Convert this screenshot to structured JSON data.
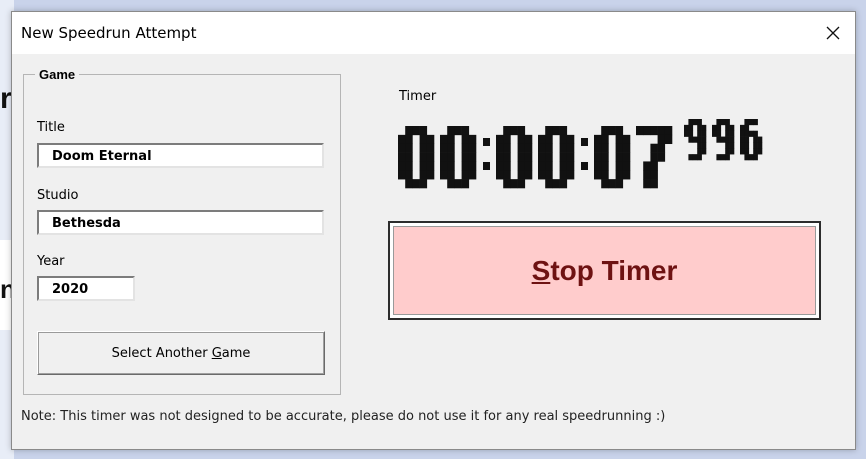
{
  "window": {
    "title": "New Speedrun Attempt",
    "close_icon": "close-icon"
  },
  "game_group": {
    "legend": "Game",
    "title_label": "Title",
    "title_value": "Doom Eternal",
    "studio_label": "Studio",
    "studio_value": "Bethesda",
    "year_label": "Year",
    "year_value": "2020",
    "select_button": {
      "before": "Select Another ",
      "accel": "G",
      "after": "ame"
    }
  },
  "timer": {
    "label": "Timer",
    "hours": "00",
    "minutes": "00",
    "seconds": "07",
    "milliseconds": "996"
  },
  "stop_button": {
    "accel": "S",
    "rest": "top Timer",
    "bg_color": "#ffcccc",
    "text_color": "#6e1212"
  },
  "note": "Note: This timer was not designed to be accurate, please do not use it for any real speedrunning :)",
  "background_app": {
    "glyphs": [
      "r",
      "n"
    ]
  }
}
